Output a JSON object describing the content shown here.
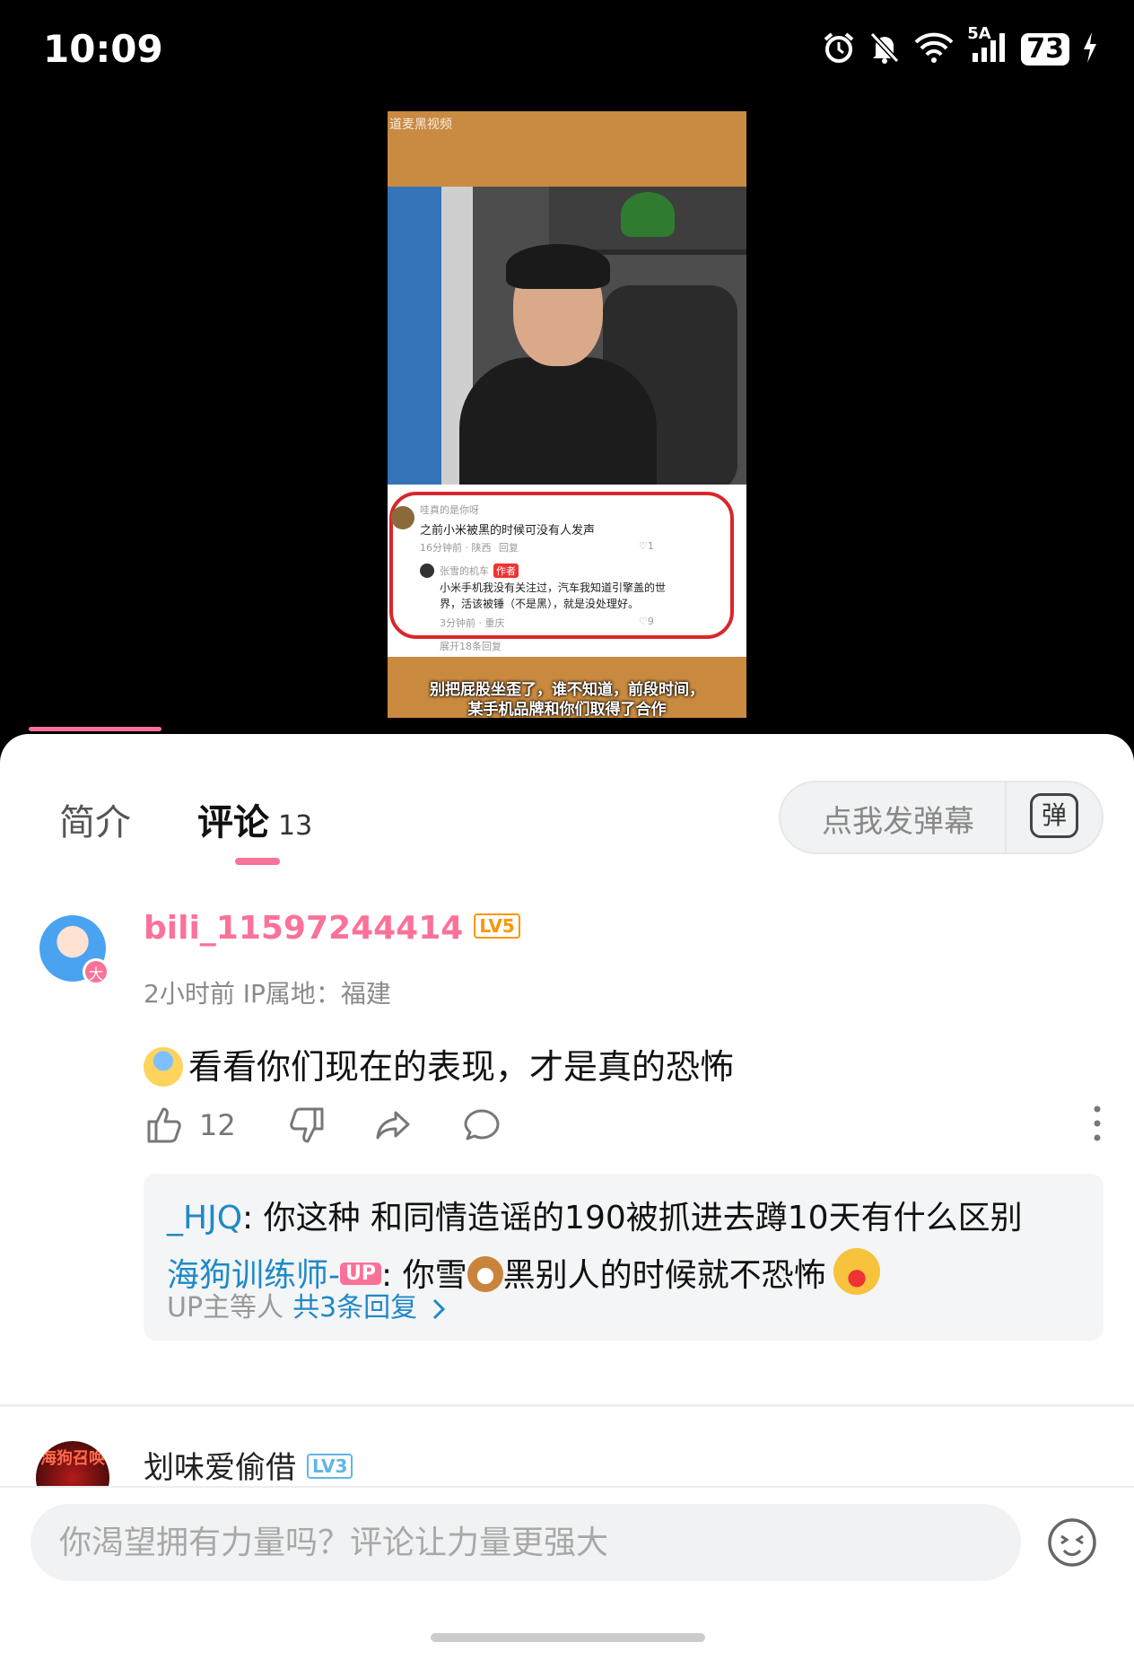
{
  "status_bar": {
    "time": "10:09",
    "network": "5A",
    "battery": "73"
  },
  "video": {
    "top_text": "道麦黑视频",
    "subtitle_line1": "别把屁股坐歪了，谁不知道，前段时间，",
    "subtitle_line2": "某手机品牌和你们取得了合作",
    "embedded_comment": {
      "user": "哇真的是你呀",
      "text": "之前小米被黑的时候可没有人发声",
      "meta": "16分钟前 · 陕西",
      "reply_label": "回复",
      "likes": "1",
      "reply_user": "张雪的机车",
      "author_tag": "作者",
      "reply_text1": "小米手机我没有关注过，汽车我知道引擎盖的世",
      "reply_text2": "界，活该被锤（不是黑），就是没处理好。",
      "reply_meta": "3分钟前 · 重庆",
      "reply_likes": "9",
      "expand": "展开18条回复"
    }
  },
  "tabs": {
    "intro": "简介",
    "comments": "评论",
    "comments_count": "13"
  },
  "danmaku": {
    "placeholder": "点我发弹幕",
    "icon_label": "弹"
  },
  "comment1": {
    "username": "bili_11597244414",
    "level": "LV5",
    "badge": "大",
    "meta": "2小时前 IP属地：福建",
    "text": "看看你们现在的表现，才是真的恐怖",
    "likes": "12",
    "replies": [
      {
        "user": "_HJQ",
        "sep": ": ",
        "text": "你这种 和同情造谣的190被抓进去蹲10天有什么区别"
      },
      {
        "user": "海狗训练师-",
        "tag": "UP",
        "sep": ": ",
        "text_before": "你雪",
        "text_after": "黑别人的时候就不恐怖"
      }
    ],
    "more_prefix": "UP主等人",
    "more_link": "共3条回复"
  },
  "comment2": {
    "username": "划味爱偷借",
    "level": "LV3",
    "avatar_text": "海狗召唤"
  },
  "input": {
    "placeholder": "你渴望拥有力量吗？评论让力量更强大"
  },
  "colors": {
    "accent": "#fb7299",
    "link": "#1e89c8",
    "level5": "#ff9500",
    "level3": "#5fb6e8"
  }
}
